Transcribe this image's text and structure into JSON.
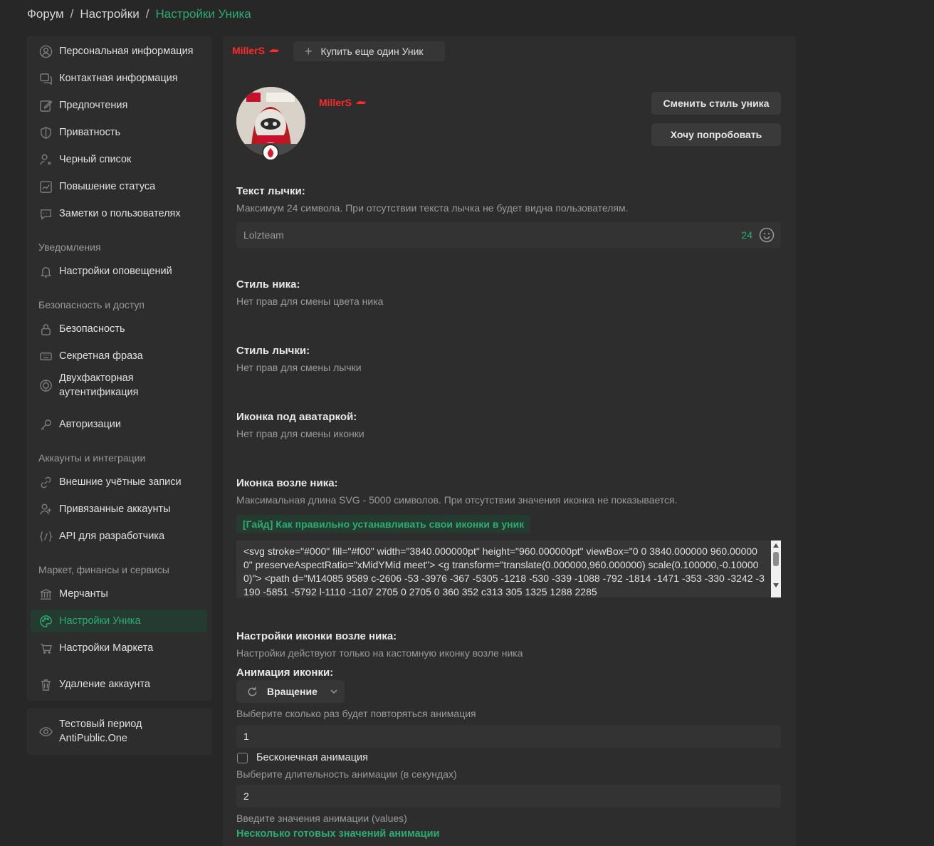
{
  "breadcrumb": [
    "Форум",
    "Настройки",
    "Настройки Уника"
  ],
  "sidebar": {
    "group1": [
      {
        "label": "Персональная информация",
        "icon": "user-circle-icon"
      },
      {
        "label": "Контактная информация",
        "icon": "chat-icon"
      },
      {
        "label": "Предпочтения",
        "icon": "edit-icon"
      },
      {
        "label": "Приватность",
        "icon": "shield-icon"
      },
      {
        "label": "Черный список",
        "icon": "user-block-icon"
      },
      {
        "label": "Повышение статуса",
        "icon": "chart-up-icon"
      },
      {
        "label": "Заметки о пользователях",
        "icon": "note-icon"
      }
    ],
    "head_notifications": "Уведомления",
    "notifications": [
      {
        "label": "Настройки оповещений",
        "icon": "bell-icon"
      }
    ],
    "head_security": "Безопасность и доступ",
    "security": [
      {
        "label": "Безопасность",
        "icon": "lock-icon"
      },
      {
        "label": "Секретная фраза",
        "icon": "keyboard-icon"
      },
      {
        "label_line1": "Двухфакторная",
        "label_line2": "аутентификация",
        "icon": "two-factor-icon"
      },
      {
        "label": "Авторизации",
        "icon": "key-icon"
      }
    ],
    "head_accounts": "Аккаунты и интеграции",
    "accounts": [
      {
        "label": "Внешние учётные записи",
        "icon": "link-icon"
      },
      {
        "label": "Привязанные аккаунты",
        "icon": "user-plus-icon"
      },
      {
        "label": "API для разработчика",
        "icon": "code-icon"
      }
    ],
    "head_market": "Маркет, финансы и сервисы",
    "market": [
      {
        "label": "Мерчанты",
        "icon": "bank-icon"
      },
      {
        "label": "Настройки Уника",
        "icon": "palette-icon",
        "active": true
      },
      {
        "label": "Настройки Маркета",
        "icon": "cart-icon"
      }
    ],
    "delete": {
      "label": "Удаление аккаунта",
      "icon": "trash-icon"
    },
    "trial": {
      "line1": "Тестовый период",
      "line2": "AntiPublic.One",
      "icon": "eye-icon"
    }
  },
  "main": {
    "tab_nick": "MillerS",
    "buy_button": "Купить еще один Уник",
    "profile_nick": "MillerS",
    "change_style_button": "Сменить стиль уника",
    "try_button": "Хочу попробовать",
    "banner_text": {
      "label": "Текст лычки:",
      "hint": "Максимум 24 символа. При отсутствии текста лычка не будет видна пользователям.",
      "placeholder": "Lolzteam",
      "counter": "24"
    },
    "nick_style": {
      "label": "Стиль ника:",
      "hint": "Нет прав для смены цвета ника"
    },
    "banner_style": {
      "label": "Стиль лычки:",
      "hint": "Нет прав для смены лычки"
    },
    "avatar_icon": {
      "label": "Иконка под аватаркой:",
      "hint": "Нет прав для смены иконки"
    },
    "nick_icon": {
      "label": "Иконка возле ника:",
      "hint": "Максимальная длина SVG - 5000 символов. При отсутствии значения иконка не показывается.",
      "guide": "[Гайд] Как правильно устанавливать свои иконки в уник",
      "svg_value": "<svg stroke=\"#000\" fill=\"#f00\" width=\"3840.000000pt\" height=\"960.000000pt\" viewBox=\"0 0 3840.000000 960.000000\" preserveAspectRatio=\"xMidYMid meet\"> <g transform=\"translate(0.000000,960.000000) scale(0.100000,-0.100000)\"> <path d=\"M14085 9589 c-2606 -53 -3976 -367 -5305 -1218 -530 -339 -1088 -792 -1814 -1471 -353 -330 -3242 -3190 -5851 -5792 l-1110 -1107 2705 0 2705 0 360 352 c313 305 1325 1288 2285"
    },
    "nick_icon_settings": {
      "label": "Настройки иконки возле ника:",
      "hint": "Настройки действуют только на кастомную иконку возле ника"
    },
    "animation": {
      "label": "Анимация иконки:",
      "selected": "Вращение",
      "repeat_hint": "Выберите сколько раз будет повторяться анимация",
      "repeat_value": "1",
      "infinite_label": "Бесконечная анимация",
      "duration_hint": "Выберите длительность анимации (в секундах)",
      "duration_value": "2",
      "values_hint": "Введите значения анимации (values)",
      "values_link": "Несколько готовых значений анимации"
    }
  },
  "colors": {
    "accent": "#2bad72",
    "nick": "#ff2a2a",
    "background": "#272727",
    "panel": "#2d2d2d"
  }
}
